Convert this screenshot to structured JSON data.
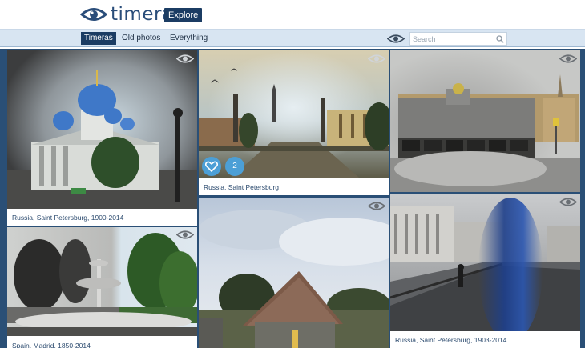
{
  "header": {
    "logo_text": "timera",
    "explore_label": "Explore"
  },
  "nav": {
    "tabs": [
      {
        "label": "Timeras",
        "active": true
      },
      {
        "label": "Old photos",
        "active": false
      },
      {
        "label": "Everything",
        "active": false
      }
    ],
    "search_placeholder": "Search"
  },
  "photos": [
    {
      "caption": "Russia, Saint Petersburg, 1900-2014"
    },
    {
      "caption": "Russia, Saint Petersburg",
      "likes": "2"
    },
    {
      "caption": ""
    },
    {
      "caption": "Spain, Madrid, 1850-2014"
    },
    {
      "caption": ""
    },
    {
      "caption": "Russia, Saint Petersburg, 1903-2014"
    }
  ],
  "colors": {
    "brand_navy": "#1b3c63",
    "nav_bg": "#d8e5f2",
    "grid_bg": "#2a4f76",
    "like_blue": "#4c9fd6"
  }
}
